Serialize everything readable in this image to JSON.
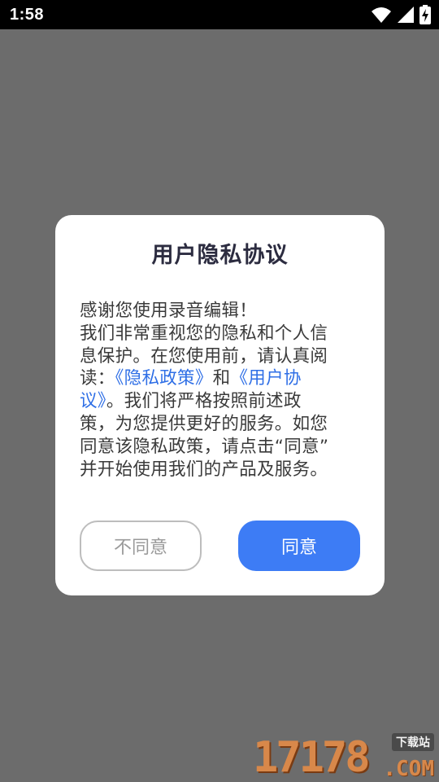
{
  "status_bar": {
    "time": "1:58",
    "icons": [
      "wifi-icon",
      "cellular-signal-icon",
      "battery-charging-icon"
    ]
  },
  "dialog": {
    "title": "用户隐私协议",
    "body": {
      "line1": "感谢您使用录音编辑！",
      "line2": "我们非常重视您的隐私和个人信",
      "line3": "息保护。在您使用前，请认真阅",
      "line4_prefix": "读：",
      "privacy_policy_link": "《隐私政策》",
      "line4_and": "和",
      "user_agreement_link_part1": "《用户协",
      "user_agreement_link_part2": "议》",
      "line5_suffix": "。我们将严格按照前述政",
      "line6": "策，为您提供更好的服务。如您",
      "line7": "同意该隐私政策，请点击“同意”",
      "line8": "并开始使用我们的产品及服务。"
    },
    "disagree_label": "不同意",
    "agree_label": "同意"
  },
  "watermark": {
    "number": "17178",
    "tag": "下载站",
    "domain": ".COM"
  },
  "colors": {
    "overlay": "#6c6c6c",
    "status_bar": "#000000",
    "link": "#2f6fe6",
    "agree_button": "#3d7cf5",
    "title_text": "#2c2c40"
  }
}
